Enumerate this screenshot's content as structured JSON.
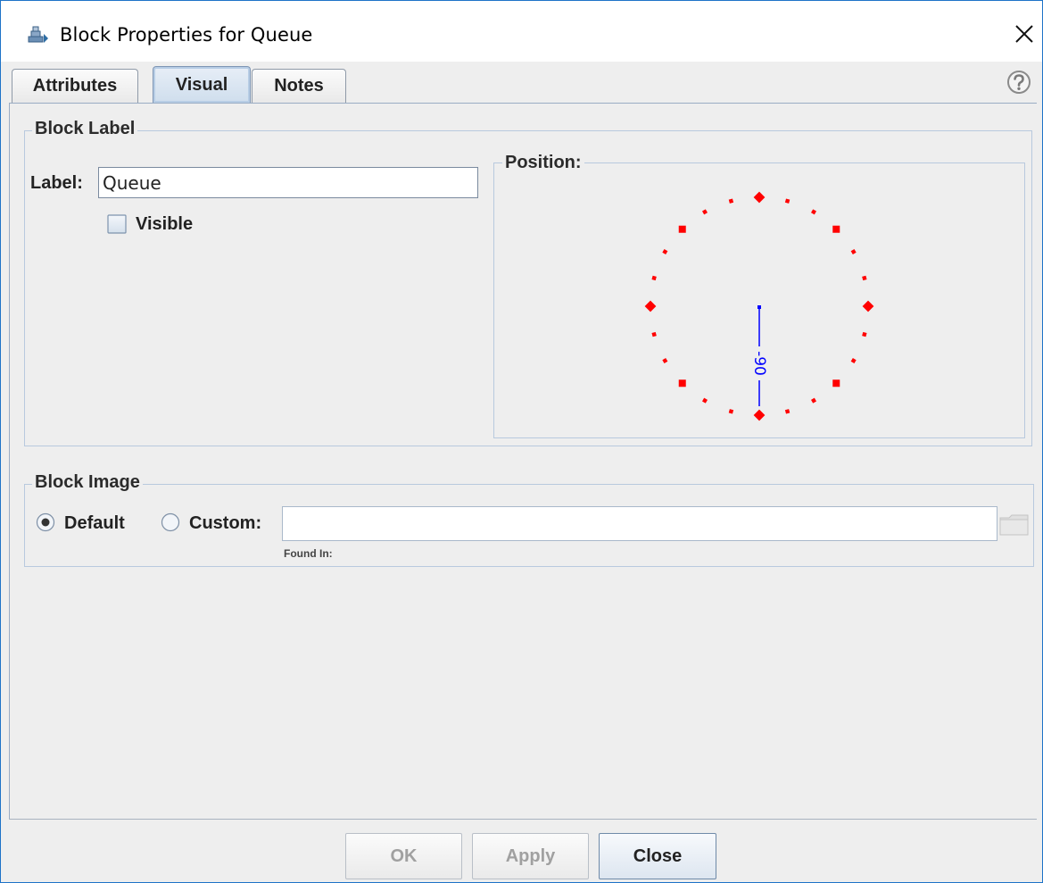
{
  "window": {
    "title": "Block Properties for Queue",
    "app_icon": "block-properties-icon",
    "close_icon": "close-icon"
  },
  "tabs": [
    {
      "label": "Attributes",
      "selected": false
    },
    {
      "label": "Visual",
      "selected": true
    },
    {
      "label": "Notes",
      "selected": false
    }
  ],
  "help_icon": "help-icon",
  "block_label": {
    "title": "Block Label",
    "label_caption": "Label:",
    "label_value": "Queue",
    "visible_label": "Visible",
    "visible_checked": false
  },
  "position": {
    "title": "Position:",
    "angle_text": "-90",
    "marker_color": "#ff0000",
    "indicator_color": "#0000ff"
  },
  "block_image": {
    "title": "Block Image",
    "default_label": "Default",
    "custom_label": "Custom:",
    "selected": "Default",
    "custom_value": "",
    "found_in_label": "Found In:",
    "folder_icon": "folder-icon"
  },
  "buttons": {
    "ok": "OK",
    "apply": "Apply",
    "close": "Close",
    "ok_enabled": false,
    "apply_enabled": false
  }
}
